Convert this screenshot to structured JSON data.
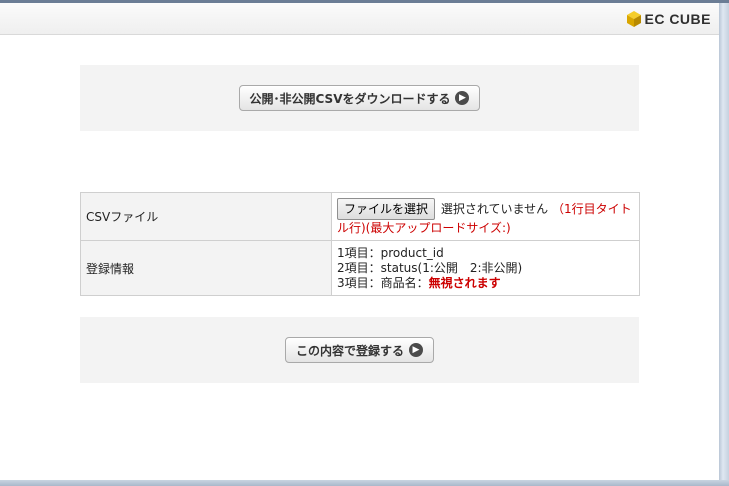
{
  "header": {
    "logo_text": "EC CUBE"
  },
  "download_button": {
    "label": "公開･非公開CSVをダウンロードする"
  },
  "form": {
    "csv_file": {
      "label": "CSVファイル",
      "choose_button": "ファイルを選択",
      "status": "選択されていません",
      "note_line1": "（1行目タイト",
      "note_line2": "ル行)(最大アップロードサイズ:)"
    },
    "registration_info": {
      "label": "登録情報",
      "line1": "1項目：product_id",
      "line2": "2項目：status(1:公開　2:非公開)",
      "line3_prefix": "3項目：商品名：",
      "line3_emphasis": "無視されます"
    }
  },
  "submit_button": {
    "label": "この内容で登録する"
  },
  "colors": {
    "accent_red": "#cc0000",
    "panel_bg": "#f3f3f3",
    "logo_cube": "#e6b400"
  },
  "icons": {
    "button_arrow": "circle-arrow-right-icon",
    "logo": "cube-logo-icon"
  }
}
